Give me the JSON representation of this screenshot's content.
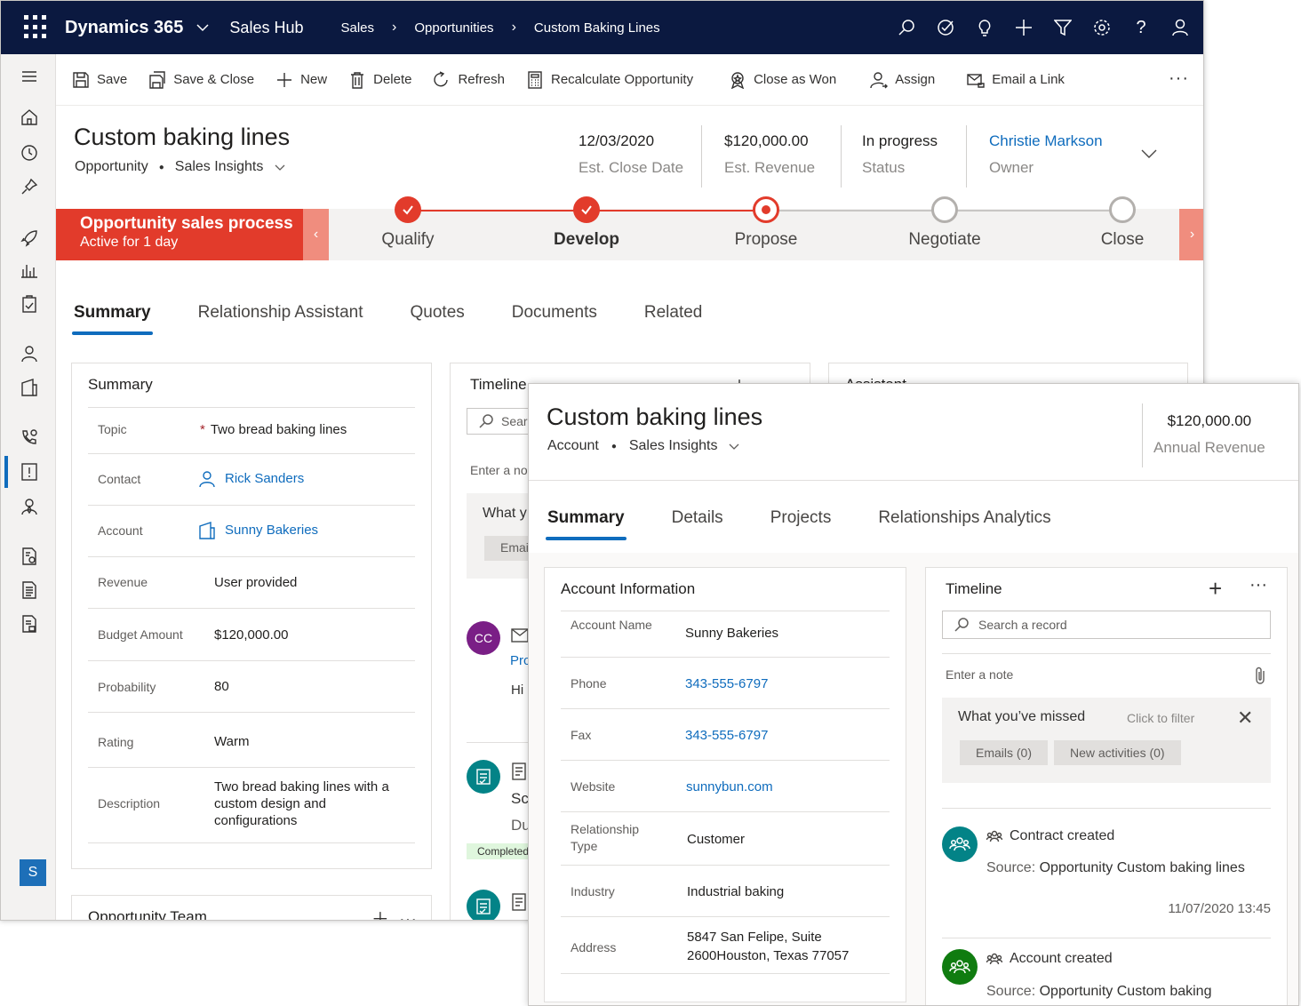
{
  "topbar": {
    "app_title": "Dynamics 365",
    "area": "Sales Hub",
    "breadcrumb": [
      "Sales",
      "Opportunities",
      "Custom Baking Lines"
    ],
    "icons": [
      "search-icon",
      "task-check-icon",
      "lightbulb-icon",
      "plus-icon",
      "filter-icon",
      "settings-icon",
      "help-icon",
      "user-icon"
    ]
  },
  "sitemap": {
    "icons": [
      "hamburger-icon",
      "home-icon",
      "recent-clock-icon",
      "pin-icon",
      "rocket-icon",
      "dashboard-icon",
      "activities-clipboard-icon",
      "contact-person-icon",
      "account-icon",
      "phone-call-icon",
      "opportunity-icon",
      "lead-person-icon",
      "quote-icon",
      "order-icon",
      "invoice-icon"
    ],
    "area_badge": "S"
  },
  "commandbar": {
    "save": "Save",
    "save_close": "Save & Close",
    "new": "New",
    "delete": "Delete",
    "refresh": "Refresh",
    "recalculate": "Recalculate Opportunity",
    "close_won": "Close as Won",
    "assign": "Assign",
    "email_link": "Email a Link",
    "more": "···"
  },
  "record": {
    "title": "Custom baking lines",
    "entity": "Opportunity",
    "form": "Sales Insights",
    "close_date": "12/03/2020",
    "close_date_label": "Est. Close Date",
    "revenue": "$120,000.00",
    "revenue_label": "Est. Revenue",
    "status": "In progress",
    "status_label": "Status",
    "owner": "Christie Markson",
    "owner_label": "Owner"
  },
  "bpf": {
    "name": "Opportunity sales process",
    "active_for": "Active for 1 day",
    "stages": [
      {
        "label": "Qualify",
        "state": "done"
      },
      {
        "label": "Develop",
        "state": "done"
      },
      {
        "label": "Propose",
        "state": "current"
      },
      {
        "label": "Negotiate",
        "state": "todo"
      },
      {
        "label": "Close",
        "state": "todo"
      }
    ],
    "colors": {
      "active": "#e23b2b",
      "nav": "#f08d7e"
    }
  },
  "tabs": [
    "Summary",
    "Relationship Assistant",
    "Quotes",
    "Documents",
    "Related"
  ],
  "summary": {
    "title": "Summary",
    "fields": [
      {
        "label": "Topic",
        "value": "Two bread baking lines"
      },
      {
        "label": "Contact",
        "value": "Rick Sanders"
      },
      {
        "label": "Account",
        "value": "Sunny Bakeries"
      },
      {
        "label": "Revenue",
        "value": "User provided"
      },
      {
        "label": "Budget Amount",
        "value": "$120,000.00"
      },
      {
        "label": "Probability",
        "value": "80"
      },
      {
        "label": "Rating",
        "value": "Warm"
      },
      {
        "label": "Description",
        "value": "Two bread baking lines with a custom design and configurations"
      }
    ]
  },
  "team": {
    "title": "Opportunity Team"
  },
  "timeline": {
    "title": "Timeline",
    "search": "Sear",
    "note": "Enter a no",
    "missed": "What y",
    "emails": "Emai",
    "entry1_initials": "CC",
    "entry1_subject": "Pro",
    "entry1_body": "Hi",
    "entry2_title": "Scl",
    "entry2_sub": "Du",
    "entry2_badge": "Completed"
  },
  "assistant": {
    "title": "Assistant"
  },
  "overlay": {
    "title": "Custom baking lines",
    "entity": "Account",
    "form": "Sales Insights",
    "revenue": "$120,000.00",
    "revenue_label": "Annual Revenue",
    "tabs": [
      "Summary",
      "Details",
      "Projects",
      "Relationships Analytics"
    ],
    "account_info": {
      "title": "Account Information",
      "fields": [
        {
          "label": "Account Name",
          "value": "Sunny Bakeries"
        },
        {
          "label": "Phone",
          "value": "343-555-6797"
        },
        {
          "label": "Fax",
          "value": "343-555-6797"
        },
        {
          "label": "Website",
          "value": "sunnybun.com"
        },
        {
          "label": "Relationship Type",
          "value": "Customer"
        },
        {
          "label": "Industry",
          "value": "Industrial baking"
        },
        {
          "label": "Address",
          "value": "5847 San Felipe, Suite 2600Houston, Texas 77057"
        }
      ]
    },
    "timeline": {
      "title": "Timeline",
      "add": "+",
      "more": "···",
      "search_placeholder": "Search a record",
      "note_placeholder": "Enter a note",
      "missed_title": "What you’ve missed",
      "missed_filter": "Click to filter",
      "close": "✕",
      "emails": "Emails (0)",
      "new_activities": "New activities (0)",
      "entries": [
        {
          "title": "Contract created",
          "source_prefix": "Source:",
          "source": "Opportunity Custom baking lines",
          "time": "11/07/2020 13:45",
          "color": "#038387"
        },
        {
          "title": "Account created",
          "source_prefix": "Source:",
          "source": "Opportunity Custom baking",
          "color": "#107c10"
        }
      ]
    }
  }
}
